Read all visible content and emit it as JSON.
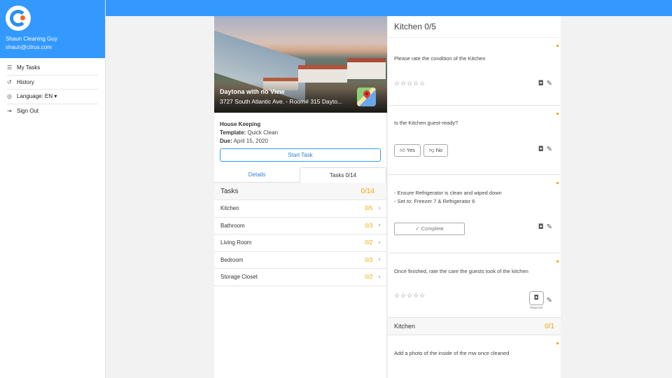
{
  "user": {
    "name": "Shaun Cleaning Guy",
    "email": "shaun@cilrus.com"
  },
  "nav": [
    {
      "icon": "list-icon",
      "glyph": "☰",
      "label": "My Tasks"
    },
    {
      "icon": "history-icon",
      "glyph": "↺",
      "label": "History"
    },
    {
      "icon": "globe-icon",
      "glyph": "◎",
      "label": "Language: EN ▾"
    },
    {
      "icon": "sign-out-icon",
      "glyph": "⇥",
      "label": "Sign Out"
    }
  ],
  "property": {
    "name": "Daytona with no View",
    "address": "3727 South Atlantic Ave. - Room# 315 Dayto..."
  },
  "details": {
    "type": "House Keeping",
    "template_label": "Template:",
    "template": "Quick Clean",
    "due_label": "Due:",
    "due": "April 15, 2020",
    "start_button": "Start Task"
  },
  "tabs": {
    "details": "Details",
    "tasks": "Tasks 0/14"
  },
  "tasks": {
    "header": "Tasks",
    "count": "0/14",
    "rows": [
      {
        "name": "Kitchen",
        "count": "0/5"
      },
      {
        "name": "Bathroom",
        "count": "0/3"
      },
      {
        "name": "Living Room",
        "count": "0/2"
      },
      {
        "name": "Bedroom",
        "count": "0/3"
      },
      {
        "name": "Storage Closet",
        "count": "0/2"
      }
    ]
  },
  "detail_panel": {
    "title": "Kitchen 0/5",
    "cards": [
      {
        "question": "Please rate the condition of the Kitchen",
        "stars": "☆☆☆☆☆"
      },
      {
        "question": "Is the Kitchen guest-ready?",
        "yes": "Yes",
        "no": "No"
      },
      {
        "line1": "- Ensure Refrigerator is clean and wiped down",
        "line2": "- Set to: Freezer 7 & Refrigerator 6",
        "complete": "Complete"
      },
      {
        "question": "Once finished, rate the care the guests took of the kitchen",
        "stars": "☆☆☆☆☆",
        "required": "Required"
      }
    ],
    "section2": {
      "title": "Kitchen",
      "count": "0/1"
    },
    "card5": {
      "question": "Add a photo of the inside of the mw once cleaned"
    }
  },
  "colors": {
    "primary": "#3399ff",
    "accent": "#f0a500"
  }
}
